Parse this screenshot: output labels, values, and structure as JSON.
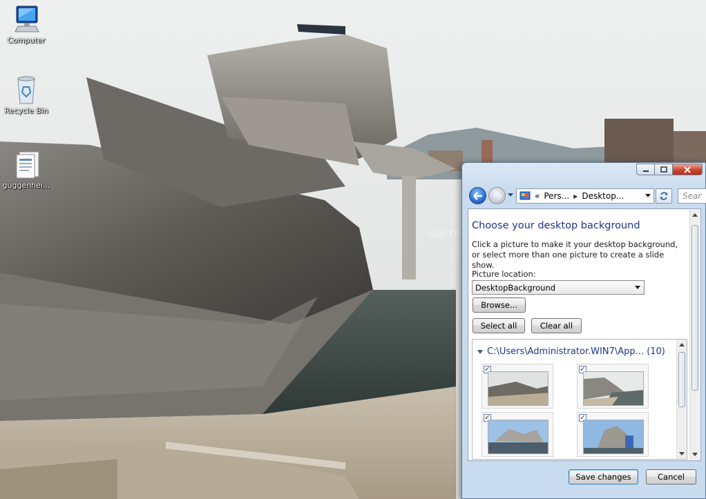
{
  "desktop": {
    "icons": [
      {
        "label": "Computer",
        "icon": "computer-icon"
      },
      {
        "label": "Recycle Bin",
        "icon": "recycle-bin-icon"
      },
      {
        "label": "guggenhei...",
        "icon": "document-icon"
      }
    ],
    "watermark": "SOFTPEDIA"
  },
  "window": {
    "nav": {
      "address_segments": [
        "«",
        "Pers...",
        "Desktop..."
      ],
      "search_placeholder": "Sear"
    },
    "title": "Choose your desktop background",
    "description": "Click a picture to make it your desktop background, or select more than one picture to create a slide show.",
    "picture_location_label": "Picture location:",
    "picture_location_value": "DesktopBackground",
    "browse_label": "Browse...",
    "select_all_label": "Select all",
    "clear_all_label": "Clear all",
    "group": {
      "path": "C:\\Users\\Administrator.WIN7\\App...",
      "count": "(10)"
    },
    "thumbnails": [
      {
        "checked": true
      },
      {
        "checked": true
      },
      {
        "checked": true
      },
      {
        "checked": true
      }
    ],
    "save_label": "Save changes",
    "cancel_label": "Cancel"
  },
  "colors": {
    "title_blue": "#1e3287",
    "window_frame": "#c9dbee",
    "close_red": "#c9462f"
  }
}
